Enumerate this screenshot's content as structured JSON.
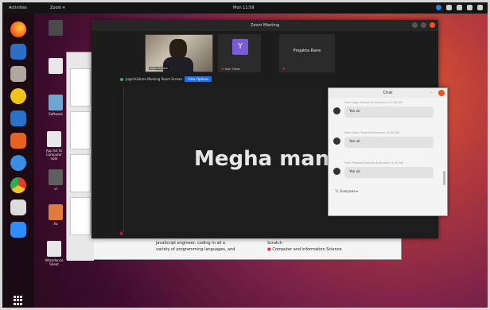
{
  "topbar": {
    "activities": "Activities",
    "app_menu": "Zoom ▾",
    "clock": "Mon 11:59"
  },
  "dock_icons": [
    "firefox-icon",
    "thunderbird-icon",
    "files-icon",
    "rhythmbox-icon",
    "writer-icon",
    "software-icon",
    "help-icon",
    "chrome-icon",
    "text-editor-icon",
    "zoom-icon"
  ],
  "desktop": {
    "items": [
      {
        "label": ""
      },
      {
        "label": ""
      },
      {
        "label": "Software"
      },
      {
        "label": "App list to Computer note"
      },
      {
        "label": "vi"
      },
      {
        "label": "Aa"
      },
      {
        "label": "Attendance Sheet"
      }
    ]
  },
  "editor": {
    "line1": "JavaScript engineer, coding in all a",
    "line2": "variety of programming languages, and",
    "side1": "Scratch",
    "side2": "Computer and information Science"
  },
  "meeting": {
    "title": "Zoom Meeting",
    "participants": [
      {
        "name": "Jugal Kishore"
      },
      {
        "name": "Yash Tiwari",
        "avatar": "Y"
      },
      {
        "name": "Prajakta Rane"
      }
    ],
    "share_text": "Jugal Kishore Meeting Room Screen",
    "view_button": "View Options",
    "screen_text": "Megha mane"
  },
  "chat": {
    "title": "Chat",
    "messages": [
      {
        "meta": "From Jugal Kishore to Everyone   11:58 AM",
        "text": "Yes sir"
      },
      {
        "meta": "From Yash Tiwari to Everyone   11:58 AM",
        "text": "Yes sir"
      },
      {
        "meta": "From Prajakta Rane to Everyone   11:59 AM",
        "text": "Yes sir"
      }
    ],
    "to_label": "To:",
    "to_value": "Everyone ▾"
  },
  "colors": {
    "accent": "#e95420",
    "zoom_blue": "#1f6fe0"
  }
}
